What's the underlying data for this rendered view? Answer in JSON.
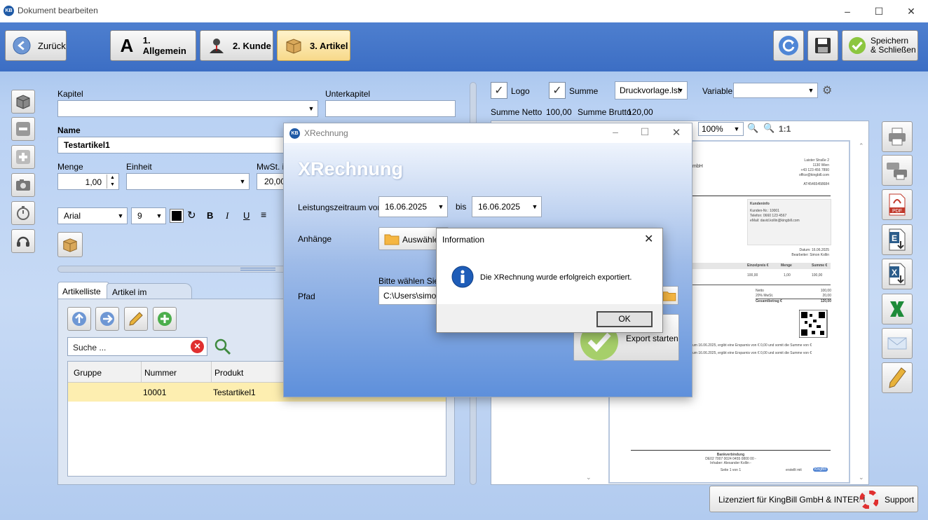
{
  "window": {
    "title": "Dokument bearbeiten",
    "logo_text": "KB"
  },
  "toolbar": {
    "back_label": "Zurück",
    "tab1_label": "1. Allgemein",
    "tab2_label": "2. Kunde",
    "tab3_label": "3. Artikel",
    "save_close_label_1": "Speichern",
    "save_close_label_2": "& Schließen"
  },
  "form": {
    "kapitel_label": "Kapitel",
    "unterkapitel_label": "Unterkapitel",
    "name_label": "Name",
    "name_value": "Testartikel1",
    "menge_label": "Menge",
    "menge_value": "1,00",
    "einheit_label": "Einheit",
    "mwst_label": "MwSt. in",
    "mwst_value": "20,00",
    "font_value": "Arial",
    "font_size_value": "9"
  },
  "tabs": {
    "artikelliste": "Artikelliste",
    "artikel_im_dokument": "Artikel im Dokument"
  },
  "search": {
    "placeholder": "Suche ..."
  },
  "table": {
    "headers": [
      "Gruppe",
      "Nummer",
      "Produkt"
    ],
    "rows": [
      {
        "gruppe": "",
        "nummer": "10001",
        "produkt": "Testartikel1"
      }
    ]
  },
  "preview_controls": {
    "logo_label": "Logo",
    "summe_label": "Summe",
    "template_value": "Druckvorlage.lst",
    "variable_label": "Variable",
    "summe_netto_label": "Summe Netto",
    "summe_netto_value": "100,00",
    "summe_brutto_label": "Summe Brutto",
    "summe_brutto_value": "120,00",
    "zoom_value": "100%",
    "zoom_reset": "1:1"
  },
  "preview_doc": {
    "company_fragment": "mbH",
    "address_lines": [
      "Laister Straße 2",
      "1130 Wien",
      "+43 123 456 7890",
      "office@kingbill.com",
      "AT45465458684"
    ],
    "customer_info_title": "Kundeninfo",
    "customer_info_lines": [
      "Kunden-Nr.:   10001",
      "Telefon:   0660 123 4567",
      "eMail:   david.kollin@kingbill.com"
    ],
    "date_line": "Datum: 16.06.2025",
    "editor_line": "Bearbeiter: Simon Kollin",
    "col_headers": [
      "Einzelpreis €",
      "Menge",
      "Summe €"
    ],
    "row_values": [
      "100,00",
      "1,00",
      "100,00"
    ],
    "totals": [
      {
        "label": "Netto",
        "value": "100,00"
      },
      {
        "label": "20% MwSt.",
        "value": "20,00"
      },
      {
        "label": "Gesamtbetrag €",
        "value": "120,00"
      }
    ],
    "note1": "um 16.06.2025, ergibt eine Ersparnis von € 0,00 und somit die Summe von €",
    "note2": "um 16.06.2025, ergibt eine Ersparnis von € 0,00 und somit die Summe von €",
    "bank_title": "Bankverbindung",
    "bank_line": "DE02 7007 0024 0455 0800 00 -",
    "owner_line": "Inhaber: Alexander Kollin -",
    "page_line": "Seite 1 von 1",
    "made_with": "erstellt mit",
    "made_with_brand": "KingBill"
  },
  "footer": {
    "license": "Lizenziert für KingBill GmbH & INTERN",
    "support": "Support"
  },
  "xrechnung": {
    "window_title": "XRechnung",
    "heading": "XRechnung",
    "period_label": "Leistungszeitraum von",
    "from_date": "16.06.2025",
    "to_label": "bis",
    "to_date": "16.06.2025",
    "attachments_label": "Anhänge",
    "attachments_button": "Auswählen",
    "path_hint": "Bitte wählen Sie e",
    "path_label": "Pfad",
    "path_value": "C:\\Users\\simon",
    "export_button": "Export starten"
  },
  "info_dialog": {
    "title": "Information",
    "message": "Die XRechnung wurde erfolgreich exportiert.",
    "ok_label": "OK"
  }
}
